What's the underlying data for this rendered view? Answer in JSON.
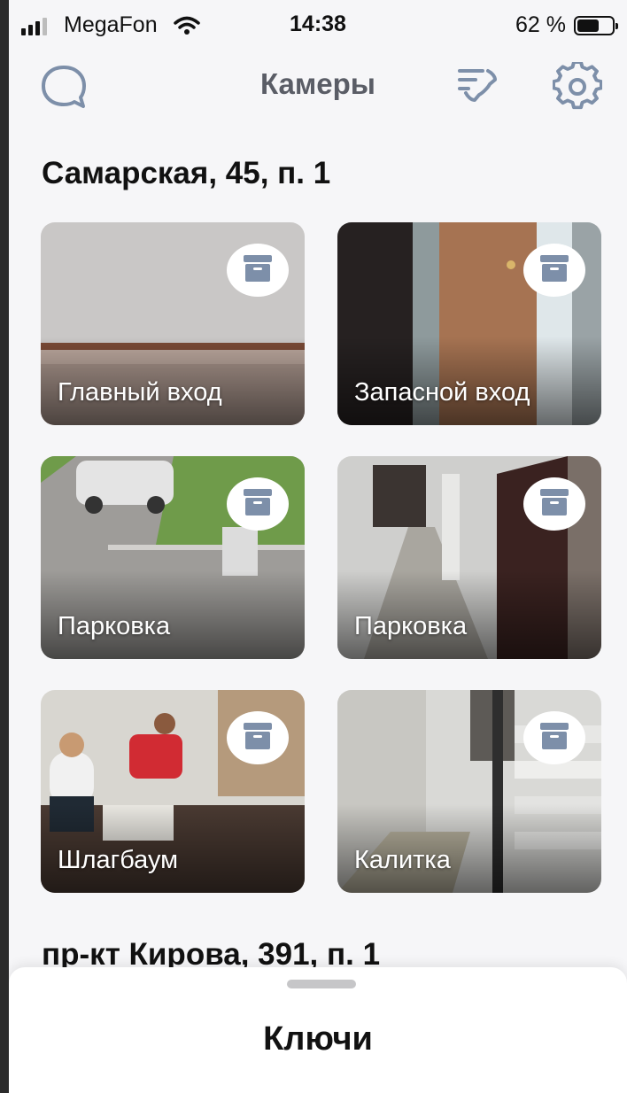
{
  "status_bar": {
    "carrier": "MegaFon",
    "time": "14:38",
    "battery_percent": "62 %",
    "battery_level": 0.62
  },
  "nav": {
    "title": "Камеры",
    "icons": [
      "chat-bubble-icon",
      "phone-call-icon",
      "gear-icon"
    ]
  },
  "sections": [
    {
      "title": "Самарская, 45, п. 1",
      "cameras": [
        {
          "name": "Главный вход",
          "icon": "archive-icon"
        },
        {
          "name": "Запасной вход",
          "icon": "archive-icon"
        },
        {
          "name": "Парковка",
          "icon": "archive-icon"
        },
        {
          "name": "Парковка",
          "icon": "archive-icon"
        },
        {
          "name": "Шлагбаум",
          "icon": "archive-icon"
        },
        {
          "name": "Калитка",
          "icon": "archive-icon"
        }
      ]
    },
    {
      "title": "пр-кт Кирова, 391, п. 1"
    }
  ],
  "bottom_sheet": {
    "title": "Ключи"
  },
  "colors": {
    "accent": "#7d8fa9",
    "background": "#f6f6f8",
    "title_gray": "#5a5d66"
  }
}
